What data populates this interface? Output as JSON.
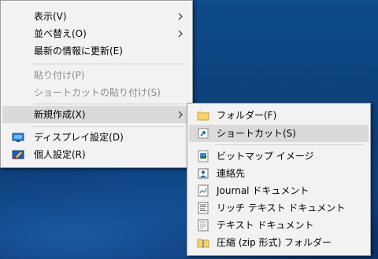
{
  "main_menu": {
    "items": [
      {
        "label": "表示(V)",
        "has_submenu": true,
        "disabled": false
      },
      {
        "label": "並べ替え(O)",
        "has_submenu": true,
        "disabled": false
      },
      {
        "label": "最新の情報に更新(E)",
        "has_submenu": false,
        "disabled": false
      },
      {
        "label": "貼り付け(P)",
        "has_submenu": false,
        "disabled": true
      },
      {
        "label": "ショートカットの貼り付け(S)",
        "has_submenu": false,
        "disabled": true
      },
      {
        "label": "新規作成(X)",
        "has_submenu": true,
        "disabled": false,
        "highlighted": true
      },
      {
        "label": "ディスプレイ設定(D)",
        "icon": "display-settings-icon"
      },
      {
        "label": "個人設定(R)",
        "icon": "personalize-icon"
      }
    ]
  },
  "submenu": {
    "items": [
      {
        "label": "フォルダー(F)",
        "icon": "folder-icon"
      },
      {
        "label": "ショートカット(S)",
        "icon": "shortcut-icon",
        "highlighted": true
      },
      {
        "label": "ビットマップ イメージ",
        "icon": "bitmap-icon"
      },
      {
        "label": "連絡先",
        "icon": "contact-icon"
      },
      {
        "label": "Journal ドキュメント",
        "icon": "journal-icon"
      },
      {
        "label": "リッチ テキスト ドキュメント",
        "icon": "rich-text-icon"
      },
      {
        "label": "テキスト ドキュメント",
        "icon": "text-document-icon"
      },
      {
        "label": "圧縮 (zip 形式) フォルダー",
        "icon": "zip-folder-icon"
      }
    ]
  },
  "colors": {
    "desktop": "#0f4c8a",
    "menu_bg": "#f2f2f2",
    "highlight": "#dadada",
    "disabled_text": "#8a8a8a"
  }
}
